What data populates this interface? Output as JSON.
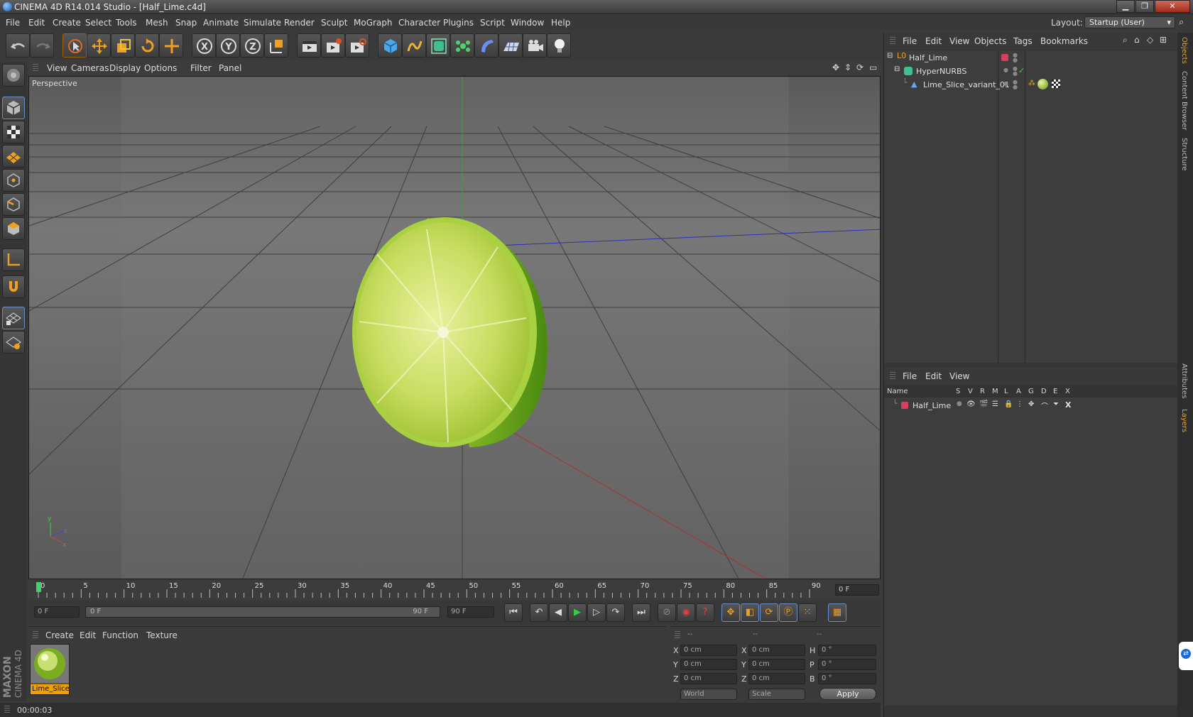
{
  "window": {
    "title": "CINEMA 4D R14.014 Studio - [Half_Lime.c4d]"
  },
  "menu": [
    "File",
    "Edit",
    "Create",
    "Select",
    "Tools",
    "Mesh",
    "Snap",
    "Animate",
    "Simulate",
    "Render",
    "Sculpt",
    "MoGraph",
    "Character",
    "Plugins",
    "Script",
    "Window",
    "Help"
  ],
  "layout": {
    "label": "Layout:",
    "value": "Startup (User)"
  },
  "viewport": {
    "menu": [
      "View",
      "Cameras",
      "Display",
      "Options",
      "Filter",
      "Panel"
    ],
    "label": "Perspective"
  },
  "timeline": {
    "ticks": [
      "0",
      "5",
      "10",
      "15",
      "20",
      "25",
      "30",
      "35",
      "40",
      "45",
      "50",
      "55",
      "60",
      "65",
      "70",
      "75",
      "80",
      "85",
      "90"
    ],
    "current_frame": "0 F",
    "start_field": "0 F",
    "range_start": "0 F",
    "range_end": "90 F",
    "end_field": "90 F"
  },
  "material_manager": {
    "menu": [
      "Create",
      "Edit",
      "Function",
      "Texture"
    ],
    "materials": [
      {
        "name": "Lime_Slice"
      }
    ]
  },
  "coords": {
    "headers": [
      "--",
      "--",
      "--"
    ],
    "rows": [
      {
        "a": "X",
        "av": "0 cm",
        "b": "X",
        "bv": "0 cm",
        "c": "H",
        "cv": "0 °"
      },
      {
        "a": "Y",
        "av": "0 cm",
        "b": "Y",
        "bv": "0 cm",
        "c": "P",
        "cv": "0 °"
      },
      {
        "a": "Z",
        "av": "0 cm",
        "b": "Z",
        "bv": "0 cm",
        "c": "B",
        "cv": "0 °"
      }
    ],
    "space": "World",
    "mode": "Scale",
    "apply": "Apply"
  },
  "status": {
    "time": "00:00:03"
  },
  "objects_panel": {
    "menu": [
      "File",
      "Edit",
      "View",
      "Objects",
      "Tags",
      "Bookmarks"
    ],
    "items": [
      "Half_Lime",
      "HyperNURBS",
      "Lime_Slice_variant_01"
    ]
  },
  "layers_panel": {
    "menu": [
      "File",
      "Edit",
      "View"
    ],
    "columns": [
      "Name",
      "S",
      "V",
      "R",
      "M",
      "L",
      "A",
      "G",
      "D",
      "E",
      "X"
    ],
    "items": [
      "Half_Lime"
    ]
  },
  "side_tabs": [
    "Objects",
    "Content Browser",
    "Structure",
    "Attributes",
    "Layers"
  ],
  "maxon": {
    "line1": "MAXON",
    "line2": "CINEMA 4D"
  },
  "colors": {
    "accent": "#f0a000",
    "layer": "#d44060",
    "viewport_bg": "#6e6e6e"
  }
}
